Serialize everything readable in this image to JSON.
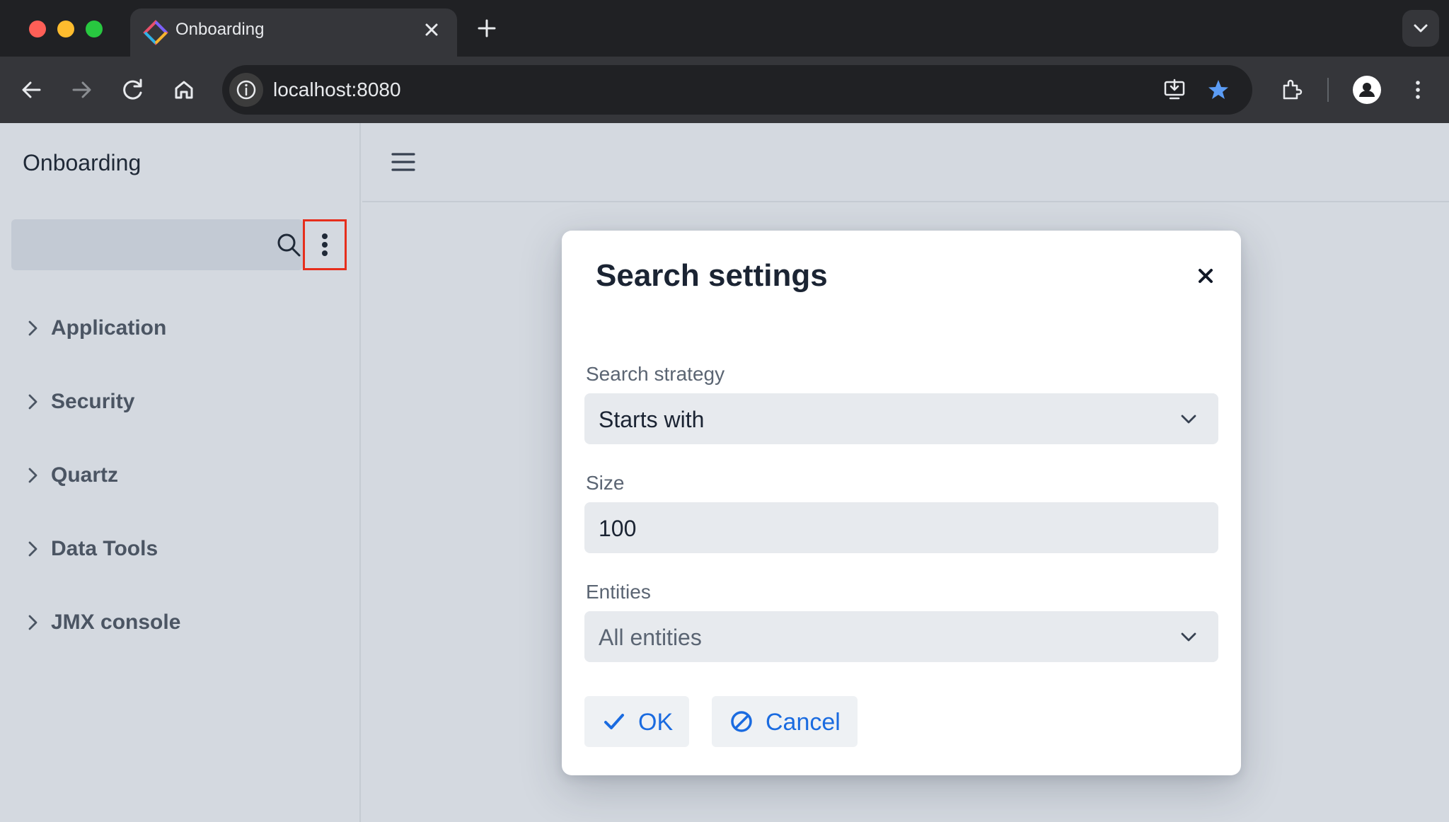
{
  "browser": {
    "tab_title": "Onboarding",
    "url": "localhost:8080",
    "colors": {
      "bookmark_star": "#5b9cf5",
      "window_bg": "#202124"
    }
  },
  "app": {
    "title": "Onboarding",
    "search": {
      "value": "",
      "placeholder": ""
    },
    "nav_items": [
      {
        "label": "Application"
      },
      {
        "label": "Security"
      },
      {
        "label": "Quartz"
      },
      {
        "label": "Data Tools"
      },
      {
        "label": "JMX console"
      }
    ]
  },
  "dialog": {
    "title": "Search settings",
    "fields": {
      "strategy": {
        "label": "Search strategy",
        "value": "Starts with"
      },
      "size": {
        "label": "Size",
        "value": "100"
      },
      "entities": {
        "label": "Entities",
        "value": "All entities"
      }
    },
    "buttons": {
      "ok": "OK",
      "cancel": "Cancel"
    },
    "colors": {
      "accent": "#1a6be0"
    }
  },
  "icons": {
    "tab": [
      "app-favicon",
      "close-icon",
      "plus-icon",
      "chevron-down-icon"
    ],
    "toolbar": [
      "back-arrow-icon",
      "forward-arrow-icon",
      "reload-icon",
      "home-icon",
      "info-icon",
      "install-app-icon",
      "star-icon",
      "extensions-icon",
      "profile-icon",
      "more-vert-icon"
    ],
    "app": [
      "search-icon",
      "kebab-menu-icon",
      "chevron-right-icon",
      "hamburger-icon"
    ],
    "dialog": [
      "close-icon",
      "chevron-down-icon",
      "check-icon",
      "ban-icon"
    ]
  },
  "highlight": {
    "target": "kebab-menu-button",
    "color": "#e62e1c"
  }
}
